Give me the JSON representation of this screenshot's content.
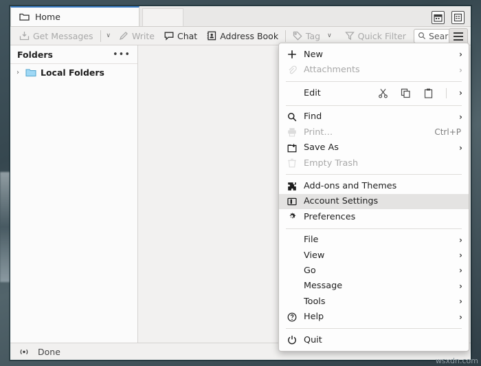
{
  "window": {
    "tab": {
      "label": "Home",
      "icon": "folder-icon"
    },
    "titlebar_icons": [
      {
        "name": "calendar-icon",
        "label": "Calendar"
      },
      {
        "name": "tasks-icon",
        "label": "Tasks"
      }
    ]
  },
  "toolbar": {
    "get_messages": {
      "label": "Get Messages",
      "icon": "download-mail-icon",
      "disabled": true
    },
    "get_messages_dropdown": {
      "label": "∨",
      "icon": "chevron-down-icon"
    },
    "write": {
      "label": "Write",
      "icon": "pencil-icon",
      "disabled": true
    },
    "chat": {
      "label": "Chat",
      "icon": "chat-bubble-icon",
      "disabled": false
    },
    "address_book": {
      "label": "Address Book",
      "icon": "address-book-icon",
      "disabled": false
    },
    "tag": {
      "label": "Tag",
      "icon": "tag-icon",
      "disabled": true
    },
    "tag_caret": "∨",
    "quick_filter": {
      "label": "Quick Filter",
      "icon": "funnel-icon",
      "disabled": true
    },
    "search": {
      "value": "Search <C",
      "placeholder": "Search <Ctrl+K>",
      "icon": "search-icon"
    },
    "app_menu_button": {
      "label": "Application Menu",
      "icon": "hamburger-icon"
    }
  },
  "folder_pane": {
    "header": "Folders",
    "more_label": "•••",
    "items": [
      {
        "label": "Local Folders",
        "icon": "folder-icon",
        "twisty": "›",
        "expanded": false
      }
    ]
  },
  "status_bar": {
    "icon": "connection-icon",
    "text": "Done"
  },
  "app_menu": {
    "groups": [
      {
        "items": [
          {
            "label": "New",
            "icon": "plus-icon",
            "submenu": true,
            "disabled": false,
            "indent": false
          },
          {
            "label": "Attachments",
            "icon": "paperclip-icon",
            "submenu": true,
            "disabled": true,
            "indent": false
          }
        ]
      },
      {
        "edit_row": {
          "label": "Edit",
          "tools": [
            {
              "name": "cut-icon",
              "label": "Cut"
            },
            {
              "name": "copy-icon",
              "label": "Copy"
            },
            {
              "name": "paste-icon",
              "label": "Paste"
            }
          ],
          "submenu": true
        }
      },
      {
        "items": [
          {
            "label": "Find",
            "icon": "search-icon",
            "submenu": true,
            "disabled": false,
            "indent": false
          },
          {
            "label": "Print…",
            "icon": "printer-icon",
            "submenu": false,
            "disabled": true,
            "indent": false,
            "accel": "Ctrl+P"
          },
          {
            "label": "Save As",
            "icon": "save-as-icon",
            "submenu": true,
            "disabled": false,
            "indent": false
          },
          {
            "label": "Empty Trash",
            "icon": "trash-icon",
            "submenu": false,
            "disabled": true,
            "indent": false
          }
        ]
      },
      {
        "items": [
          {
            "label": "Add-ons and Themes",
            "icon": "puzzle-icon",
            "submenu": false,
            "disabled": false,
            "indent": false
          },
          {
            "label": "Account Settings",
            "icon": "account-settings-icon",
            "submenu": false,
            "disabled": false,
            "indent": false,
            "highlighted": true
          },
          {
            "label": "Preferences",
            "icon": "gear-icon",
            "submenu": false,
            "disabled": false,
            "indent": false
          }
        ]
      },
      {
        "items": [
          {
            "label": "File",
            "icon": "",
            "submenu": true,
            "disabled": false,
            "indent": true
          },
          {
            "label": "View",
            "icon": "",
            "submenu": true,
            "disabled": false,
            "indent": true
          },
          {
            "label": "Go",
            "icon": "",
            "submenu": true,
            "disabled": false,
            "indent": true
          },
          {
            "label": "Message",
            "icon": "",
            "submenu": true,
            "disabled": false,
            "indent": true
          },
          {
            "label": "Tools",
            "icon": "",
            "submenu": true,
            "disabled": false,
            "indent": true
          },
          {
            "label": "Help",
            "icon": "help-icon",
            "submenu": true,
            "disabled": false,
            "indent": false
          }
        ]
      },
      {
        "items": [
          {
            "label": "Quit",
            "icon": "power-icon",
            "submenu": false,
            "disabled": false,
            "indent": false
          }
        ]
      }
    ]
  },
  "watermark": "wsxdn.com",
  "colors": {
    "tab_accent": "#3b7cc4",
    "menu_highlight": "#e4e3e2",
    "window_border": "#1f3a42",
    "folder_blue": "#8fd0f0"
  }
}
